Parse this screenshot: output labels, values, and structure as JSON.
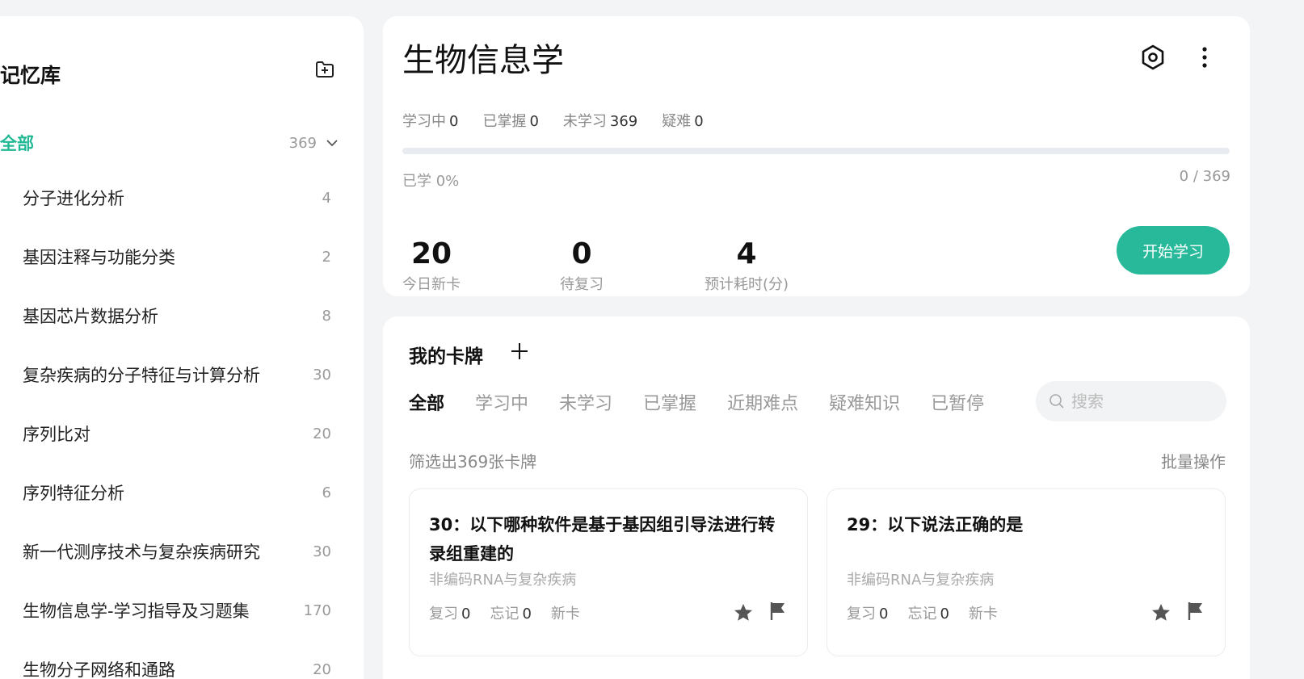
{
  "sidebar": {
    "title": "记忆库",
    "all": {
      "label": "全部",
      "count": "369"
    },
    "items": [
      {
        "label": "分子进化分析",
        "count": "4"
      },
      {
        "label": "基因注释与功能分类",
        "count": "2"
      },
      {
        "label": "基因芯片数据分析",
        "count": "8"
      },
      {
        "label": "复杂疾病的分子特征与计算分析",
        "count": "30"
      },
      {
        "label": "序列比对",
        "count": "20"
      },
      {
        "label": "序列特征分析",
        "count": "6"
      },
      {
        "label": "新一代测序技术与复杂疾病研究",
        "count": "30"
      },
      {
        "label": "生物信息学-学习指导及习题集",
        "count": "170"
      },
      {
        "label": "生物分子网络和通路",
        "count": "20"
      }
    ]
  },
  "deck": {
    "title": "生物信息学",
    "stats": [
      {
        "label": "学习中",
        "value": "0"
      },
      {
        "label": "已掌握",
        "value": "0"
      },
      {
        "label": "未学习",
        "value": "369"
      },
      {
        "label": "疑难",
        "value": "0"
      }
    ],
    "progress_percent": 0,
    "progress_label": "已学 0%",
    "progress_count": "0 / 369",
    "metrics": [
      {
        "value": "20",
        "caption": "今日新卡"
      },
      {
        "value": "0",
        "caption": "待复习"
      },
      {
        "value": "4",
        "caption": "预计耗时(分)"
      }
    ],
    "start_label": "开始学习"
  },
  "cards": {
    "heading": "我的卡牌",
    "tabs": [
      "全部",
      "学习中",
      "未学习",
      "已掌握",
      "近期难点",
      "疑难知识",
      "已暂停"
    ],
    "search_placeholder": "搜索",
    "filter_text": "筛选出369张卡牌",
    "batch_label": "批量操作",
    "items": [
      {
        "title": "30：以下哪种软件是基于基因组引导法进行转录组重建的",
        "subtitle": "非编码RNA与复杂疾病",
        "review_label": "复习",
        "review": "0",
        "forget_label": "忘记",
        "forget": "0",
        "status": "新卡"
      },
      {
        "title": "29：以下说法正确的是",
        "subtitle": "非编码RNA与复杂疾病",
        "review_label": "复习",
        "review": "0",
        "forget_label": "忘记",
        "forget": "0",
        "status": "新卡"
      }
    ]
  },
  "colors": {
    "accent": "#27b99a",
    "accent_text": "#21b894"
  },
  "icons": [
    "folder-add-icon",
    "chevron-down-icon",
    "settings-icon",
    "more-vertical-icon",
    "plus-icon",
    "search-icon",
    "star-icon",
    "flag-icon"
  ]
}
